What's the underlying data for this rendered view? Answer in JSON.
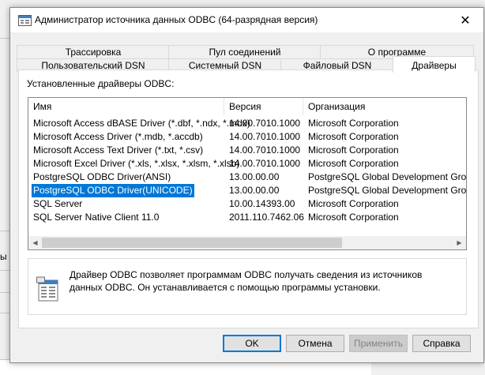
{
  "window": {
    "title": "Администратор источника данных ODBC (64-разрядная версия)",
    "close_glyph": "✕"
  },
  "background": {
    "partial_text": "ы"
  },
  "tabs": {
    "row_top": [
      "Трассировка",
      "Пул соединений",
      "О программе"
    ],
    "row_bottom": [
      "Пользовательский DSN",
      "Системный DSN",
      "Файловый DSN",
      "Драйверы"
    ],
    "active": "Драйверы"
  },
  "drivers": {
    "label": "Установленные драйверы ODBC:",
    "columns": [
      "Имя",
      "Версия",
      "Организация"
    ],
    "rows": [
      {
        "name": "Microsoft Access dBASE Driver (*.dbf, *.ndx, *.mdx)",
        "version": "14.00.7010.1000",
        "company": "Microsoft Corporation"
      },
      {
        "name": "Microsoft Access Driver (*.mdb, *.accdb)",
        "version": "14.00.7010.1000",
        "company": "Microsoft Corporation"
      },
      {
        "name": "Microsoft Access Text Driver (*.txt, *.csv)",
        "version": "14.00.7010.1000",
        "company": "Microsoft Corporation"
      },
      {
        "name": "Microsoft Excel Driver (*.xls, *.xlsx, *.xlsm, *.xlsb)",
        "version": "14.00.7010.1000",
        "company": "Microsoft Corporation"
      },
      {
        "name": "PostgreSQL ODBC Driver(ANSI)",
        "version": "13.00.00.00",
        "company": "PostgreSQL Global Development Group"
      },
      {
        "name": "PostgreSQL ODBC Driver(UNICODE)",
        "version": "13.00.00.00",
        "company": "PostgreSQL Global Development Group"
      },
      {
        "name": "SQL Server",
        "version": "10.00.14393.00",
        "company": "Microsoft Corporation"
      },
      {
        "name": "SQL Server Native Client 11.0",
        "version": "2011.110.7462.06",
        "company": "Microsoft Corporation"
      }
    ],
    "selected_row": 5
  },
  "info": {
    "text": "Драйвер ODBC позволяет программам ODBC получать сведения из источников данных ODBC.  Он устанавливается с помощью программы установки.",
    "icon": "odbc-info-icon"
  },
  "buttons": {
    "ok": "OK",
    "cancel": "Отмена",
    "apply": "Применить",
    "help": "Справка"
  },
  "colors": {
    "selection": "#0078d7",
    "default_button_border": "#0078d7"
  }
}
